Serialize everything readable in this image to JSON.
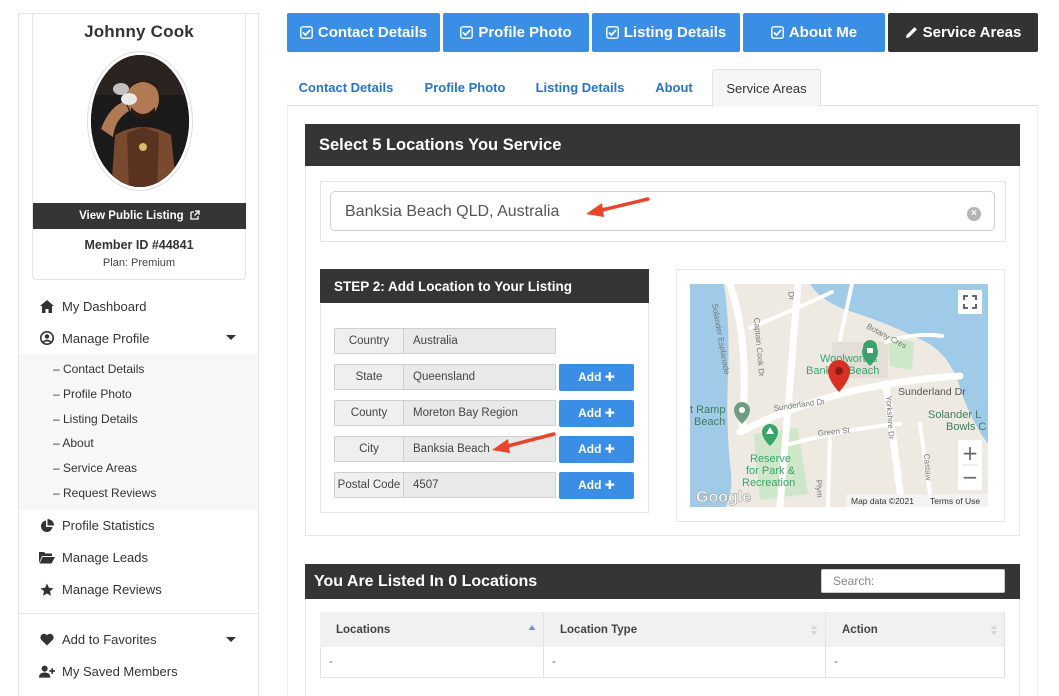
{
  "profile": {
    "name": "Johnny Cook",
    "view_listing_label": "View Public Listing",
    "member_id": "Member ID #44841",
    "plan": "Plan: Premium"
  },
  "nav": {
    "dashboard": "My Dashboard",
    "manage_profile": "Manage Profile",
    "sub_items": [
      "– Contact Details",
      "– Profile Photo",
      "– Listing Details",
      "– About",
      "– Service Areas",
      "– Request Reviews"
    ],
    "profile_statistics": "Profile Statistics",
    "manage_leads": "Manage Leads",
    "manage_reviews": "Manage Reviews",
    "add_to_favorites": "Add to Favorites",
    "saved_members": "My Saved Members"
  },
  "top_buttons": {
    "contact": "Contact Details",
    "photo": "Profile Photo",
    "listing": "Listing Details",
    "about": "About Me",
    "service": "Service Areas"
  },
  "sub_tabs": {
    "contact": "Contact Details",
    "photo": "Profile Photo",
    "listing": "Listing Details",
    "about": "About",
    "service": "Service Areas"
  },
  "locations_panel": {
    "heading": "Select 5 Locations You Service",
    "search_value": "Banksia Beach QLD, Australia"
  },
  "step2": {
    "heading": "STEP 2: Add Location to Your Listing",
    "add_label": "Add",
    "rows": [
      {
        "label": "Country",
        "value": "Australia"
      },
      {
        "label": "State",
        "value": "Queensland"
      },
      {
        "label": "County",
        "value": "Moreton Bay Region"
      },
      {
        "label": "City",
        "value": "Banksia Beach"
      },
      {
        "label": "Postal Code",
        "value": "4507"
      }
    ]
  },
  "map": {
    "labels": {
      "woolworths_1": "Woolworths",
      "woolworths_2": "Banksia Beach",
      "sunderland_dr": "Sunderland Dr",
      "sunderland_dr_2": "Sunderland Dr",
      "solander_1": "Solander L",
      "solander_2": "Bowls C",
      "boat_ramp_1": "t Ramp",
      "boat_ramp_2": "Beach",
      "reserve_1": "Reserve",
      "reserve_2": "for Park &",
      "reserve_3": "Recreation",
      "green_st": "Green St",
      "captain_cook": "Captain Cook Dr",
      "solander_esp": "Solander Esplanade",
      "yorkshire": "Yorkshire Dr",
      "botany": "Botany Cres",
      "castaway": "Castaw",
      "plymouth": "Plym",
      "dr_top": "Dr",
      "google": "Google",
      "map_data": "Map data ©2021",
      "terms": "Terms of Use",
      "zoom_in": "+",
      "zoom_out": "−"
    },
    "pin_color": "#d93025"
  },
  "listed_panel": {
    "heading": "You Are Listed In 0 Locations",
    "search_placeholder": "Search:",
    "columns": [
      "Locations",
      "Location Type",
      "Action"
    ],
    "row": [
      "-",
      "-",
      "-"
    ]
  },
  "colors": {
    "primary_blue": "#3b8ee6",
    "dark": "#333333",
    "annotation_arrow": "#e8452c"
  }
}
